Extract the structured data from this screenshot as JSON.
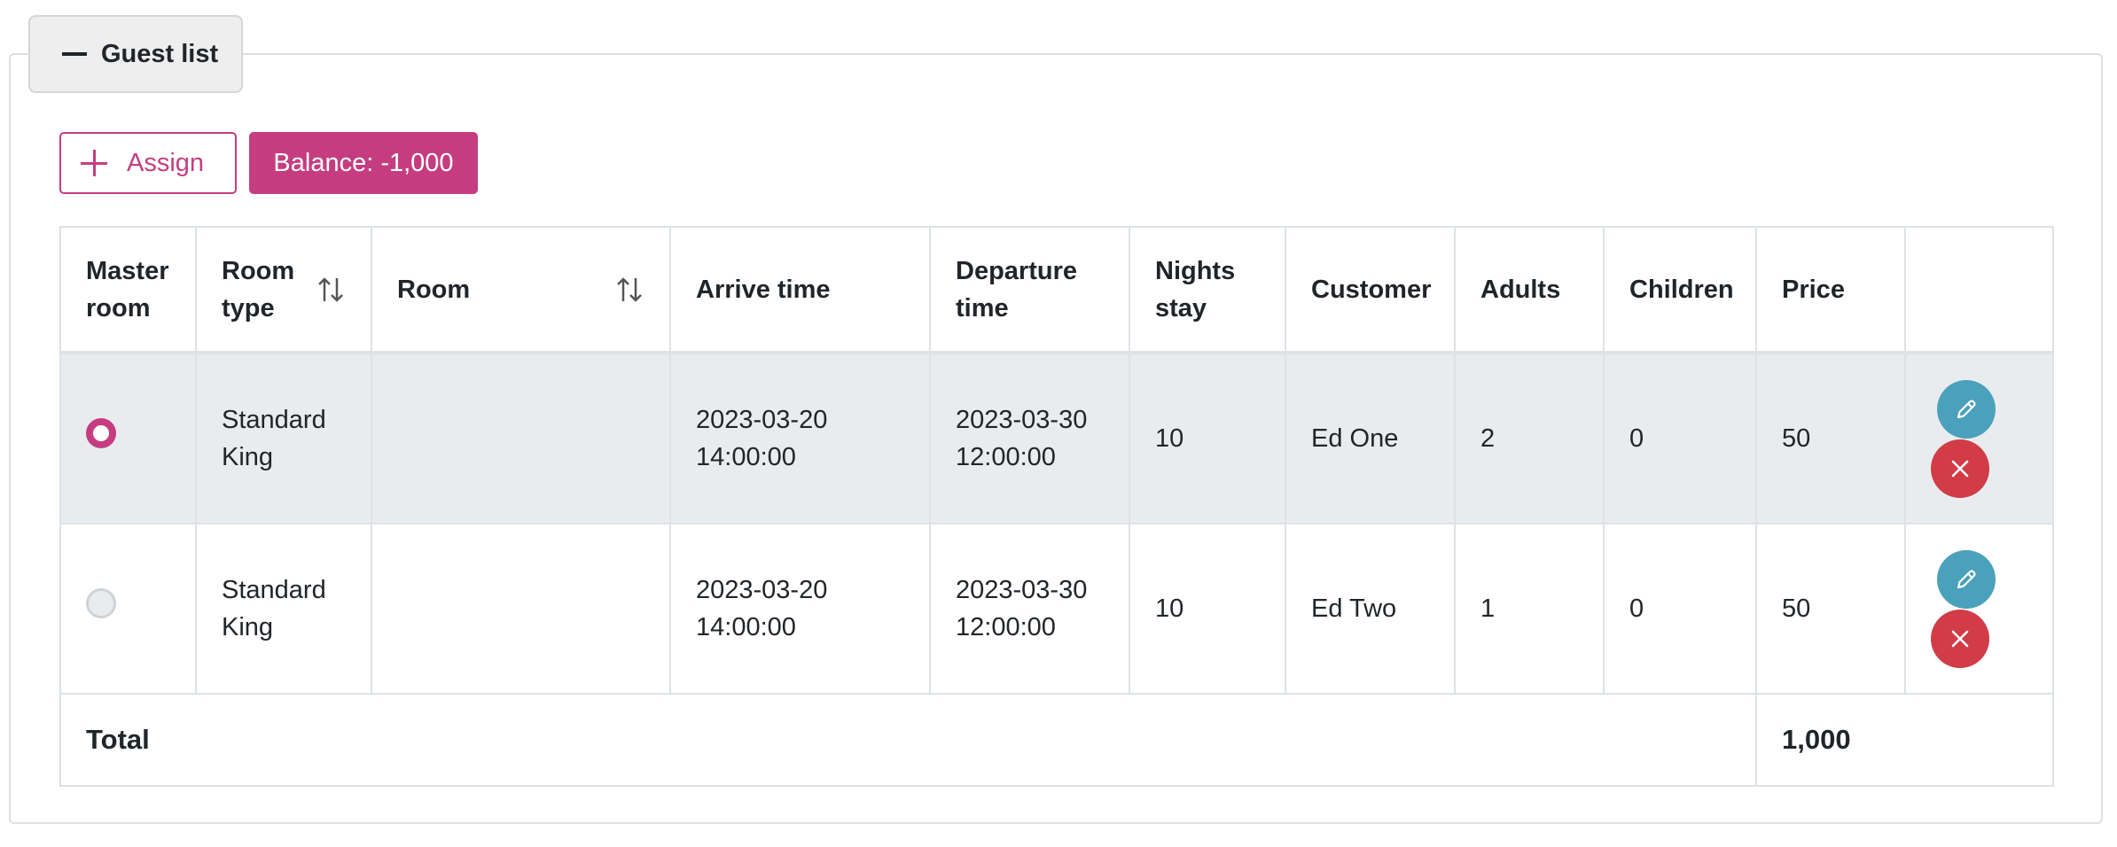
{
  "panel": {
    "title": "Guest list"
  },
  "toolbar": {
    "assign_label": "Assign",
    "balance_label": "Balance: -1,000"
  },
  "table": {
    "columns": {
      "master_room": "Master room",
      "room_type": "Room type",
      "room": "Room",
      "arrive_time": "Arrive time",
      "departure_time": "Departure time",
      "nights_stay": "Nights stay",
      "customer": "Customer",
      "adults": "Adults",
      "children": "Children",
      "price": "Price"
    },
    "rows": [
      {
        "master": true,
        "room_type": "Standard King",
        "room": "",
        "arrive_time": "2023-03-20 14:00:00",
        "departure_time": "2023-03-30 12:00:00",
        "nights": "10",
        "customer": "Ed One",
        "adults": "2",
        "children": "0",
        "price": "50"
      },
      {
        "master": false,
        "room_type": "Standard King",
        "room": "",
        "arrive_time": "2023-03-20 14:00:00",
        "departure_time": "2023-03-30 12:00:00",
        "nights": "10",
        "customer": "Ed Two",
        "adults": "1",
        "children": "0",
        "price": "50"
      }
    ],
    "total_label": "Total",
    "total_value": "1,000"
  },
  "colors": {
    "accent": "#c53d80",
    "edit": "#4aa1bb",
    "delete": "#d13c47",
    "selected_row": "#e9ecef"
  },
  "icons": {
    "collapse": "minus-icon",
    "assign": "plus-icon",
    "sort": "sort-arrows-icon",
    "edit": "pencil-icon",
    "delete": "close-icon"
  }
}
